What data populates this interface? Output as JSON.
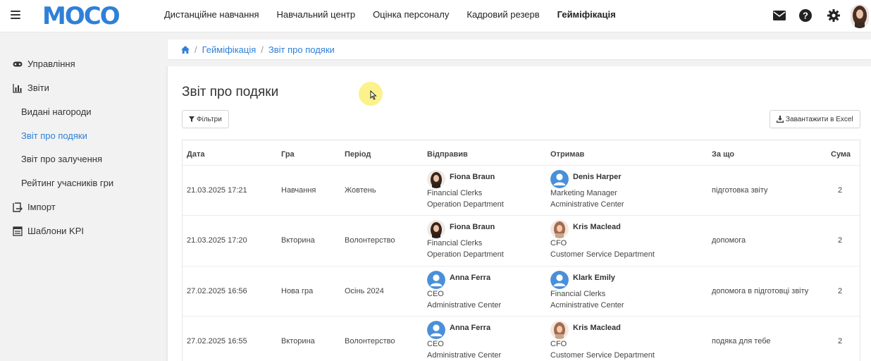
{
  "header": {
    "logo": "MOCO",
    "nav": [
      {
        "label": "Дистанційне навчання"
      },
      {
        "label": "Навчальний центр"
      },
      {
        "label": "Оцінка персоналу"
      },
      {
        "label": "Кадровий резерв"
      },
      {
        "label": "Гейміфікація",
        "active": true
      }
    ],
    "icons": [
      "mail-icon",
      "help-icon",
      "gear-icon",
      "user-avatar"
    ]
  },
  "sidebar": {
    "items": [
      {
        "label": "Управління",
        "icon": "gamepad-icon"
      },
      {
        "label": "Звіти",
        "icon": "chart-icon"
      },
      {
        "label": "Видані нагороди",
        "sub": true
      },
      {
        "label": "Звіт про подяки",
        "sub": true,
        "active": true
      },
      {
        "label": "Звіт про залучення",
        "sub": true
      },
      {
        "label": "Рейтинг учасників гри",
        "sub": true
      },
      {
        "label": "Імпорт",
        "icon": "import-icon"
      },
      {
        "label": "Шаблони KPI",
        "icon": "template-icon"
      }
    ]
  },
  "breadcrumb": {
    "home_icon": "home-icon",
    "items": [
      "Гейміфікація",
      "Звіт про подяки"
    ]
  },
  "page": {
    "title": "Звіт про подяки",
    "filters_label": "Фільтри",
    "export_label": "Завантажити в Excel"
  },
  "table": {
    "headers": [
      "Дата",
      "Гра",
      "Період",
      "Відправив",
      "Отримав",
      "За що",
      "Сума"
    ],
    "rows": [
      {
        "date": "21.03.2025 17:21",
        "game": "Навчання",
        "period": "Жовтень",
        "sender": {
          "name": "Fiona Braun",
          "position": "Financial Clerks",
          "department": "Operation Department",
          "avatar": "photo-dark"
        },
        "receiver": {
          "name": "Denis Harper",
          "position": "Marketing Manager",
          "department": "Acministrative Center",
          "avatar": "default"
        },
        "reason": "підготовка звіту",
        "amount": "2"
      },
      {
        "date": "21.03.2025 17:20",
        "game": "Вкторина",
        "period": "Волонтерство",
        "sender": {
          "name": "Fiona Braun",
          "position": "Financial Clerks",
          "department": "Operation Department",
          "avatar": "photo-dark"
        },
        "receiver": {
          "name": "Kris Maclead",
          "position": "CFO",
          "department": "Customer Service Department",
          "avatar": "photo-light"
        },
        "reason": "допомога",
        "amount": "2"
      },
      {
        "date": "27.02.2025 16:56",
        "game": "Нова гра",
        "period": "Осінь 2024",
        "sender": {
          "name": "Anna Ferra",
          "position": "CEO",
          "department": "Administrative Center",
          "avatar": "default"
        },
        "receiver": {
          "name": "Klark Emily",
          "position": "Financial Clerks",
          "department": "Acministrative Center",
          "avatar": "default"
        },
        "reason": "допомога в підготовці звіту",
        "amount": "2"
      },
      {
        "date": "27.02.2025 16:55",
        "game": "Вкторина",
        "period": "Волонтерство",
        "sender": {
          "name": "Anna Ferra",
          "position": "CEO",
          "department": "Administrative Center",
          "avatar": "default"
        },
        "receiver": {
          "name": "Kris Maclead",
          "position": "CFO",
          "department": "Customer Service Department",
          "avatar": "photo-light"
        },
        "reason": "подяка для тебе",
        "amount": "2"
      }
    ]
  },
  "colors": {
    "accent": "#2f80d8",
    "text": "#333333",
    "background": "#f2f2f2"
  }
}
